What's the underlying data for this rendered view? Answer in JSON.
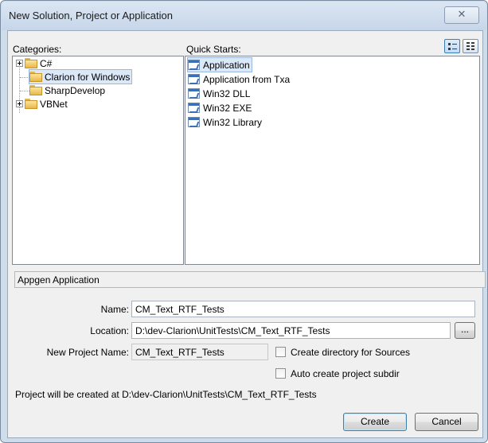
{
  "window": {
    "title": "New Solution, Project or Application",
    "close_glyph": "✕"
  },
  "categories": {
    "label": "Categories:",
    "items": [
      {
        "label": "C#",
        "expandable": true,
        "selected": false
      },
      {
        "label": "Clarion for Windows",
        "expandable": false,
        "selected": true
      },
      {
        "label": "SharpDevelop",
        "expandable": false,
        "selected": false
      },
      {
        "label": "VBNet",
        "expandable": true,
        "selected": false
      }
    ]
  },
  "quick_starts": {
    "label": "Quick Starts:",
    "items": [
      {
        "label": "Application",
        "selected": true
      },
      {
        "label": "Application from Txa",
        "selected": false
      },
      {
        "label": "Win32 DLL",
        "selected": false
      },
      {
        "label": "Win32 EXE",
        "selected": false
      },
      {
        "label": "Win32 Library",
        "selected": false
      }
    ]
  },
  "view_toggle": {
    "large_icons": "large-icons-view",
    "list": "list-view",
    "active": "large-icons-view"
  },
  "description": "Appgen Application",
  "form": {
    "name_label": "Name:",
    "name_value": "CM_Text_RTF_Tests",
    "location_label": "Location:",
    "location_value": "D:\\dev-Clarion\\UnitTests\\CM_Text_RTF_Tests",
    "browse_label": "...",
    "project_name_label": "New Project Name:",
    "project_name_value": "CM_Text_RTF_Tests",
    "create_dir_label": "Create directory for Sources",
    "create_dir_checked": false,
    "auto_subdir_label": "Auto create project subdir",
    "auto_subdir_checked": false,
    "created_at": "Project will be created at D:\\dev-Clarion\\UnitTests\\CM_Text_RTF_Tests"
  },
  "buttons": {
    "create": "Create",
    "cancel": "Cancel"
  }
}
